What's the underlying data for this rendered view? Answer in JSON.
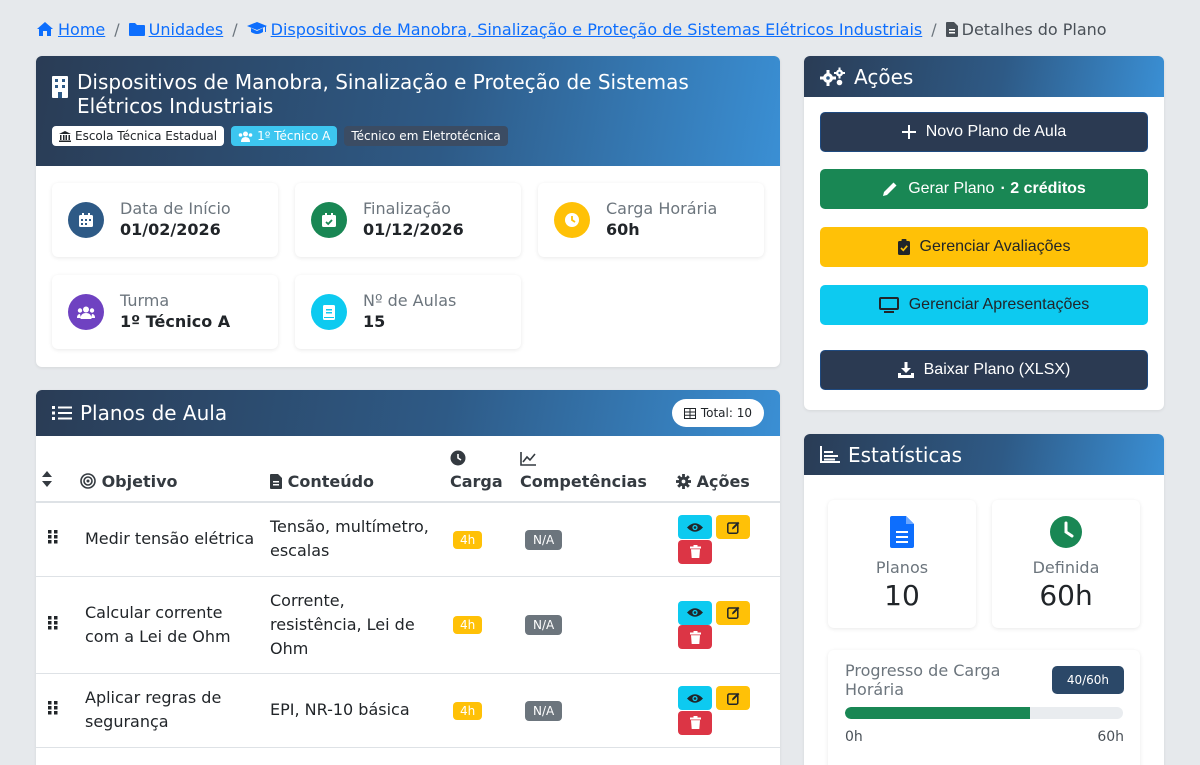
{
  "breadcrumb": {
    "home": "Home",
    "units": "Unidades",
    "course": "Dispositivos de Manobra, Sinalização e Proteção de Sistemas Elétricos Industriais",
    "current": "Detalhes do Plano",
    "separator": "/"
  },
  "plan": {
    "title": "Dispositivos de Manobra, Sinalização e Proteção de Sistemas Elétricos Industriais",
    "badges": {
      "school": "Escola Técnica Estadual",
      "class": "1º Técnico A",
      "course": "Técnico em Eletrotécnica"
    },
    "info": {
      "start_label": "Data de Início",
      "start_value": "01/02/2026",
      "end_label": "Finalização",
      "end_value": "01/12/2026",
      "hours_label": "Carga Horária",
      "hours_value": "60h",
      "class_label": "Turma",
      "class_value": "1º Técnico A",
      "lessons_label": "Nº de Aulas",
      "lessons_value": "15"
    }
  },
  "lessons": {
    "title": "Planos de Aula",
    "total": "Total: 10",
    "columns": {
      "objective": "Objetivo",
      "content": "Conteúdo",
      "load": "Carga",
      "skills": "Competências",
      "actions": "Ações"
    },
    "rows": [
      {
        "objective": "Medir tensão elétrica",
        "content": "Tensão, multímetro, escalas",
        "load": "4h",
        "skills": "N/A"
      },
      {
        "objective": "Calcular corrente com a Lei de Ohm",
        "content": "Corrente, resistência, Lei de Ohm",
        "load": "4h",
        "skills": "N/A"
      },
      {
        "objective": "Aplicar regras de segurança",
        "content": "EPI, NR-10 básica",
        "load": "4h",
        "skills": "N/A"
      }
    ]
  },
  "actions": {
    "title": "Ações",
    "new_plan": "Novo Plano de Aula",
    "generate": "Gerar Plano",
    "generate_credits": "· 2 créditos",
    "evaluations": "Gerenciar Avaliações",
    "presentations": "Gerenciar Apresentações",
    "download": "Baixar Plano (XLSX)"
  },
  "stats": {
    "title": "Estatísticas",
    "plans_label": "Planos",
    "plans_value": "10",
    "defined_label": "Definida",
    "defined_value": "60h",
    "progress_label": "Progresso de Carga Horária",
    "progress_badge": "40/60h",
    "progress_fraction": 0.667,
    "progress_min": "0h",
    "progress_max": "60h"
  },
  "colors": {
    "link": "#0d6efd",
    "header_gradient_start": "#2a3c55",
    "header_gradient_end": "#3a8fd4",
    "success": "#198754",
    "warning": "#ffc107",
    "info": "#0dcaf0",
    "danger": "#dc3545"
  }
}
